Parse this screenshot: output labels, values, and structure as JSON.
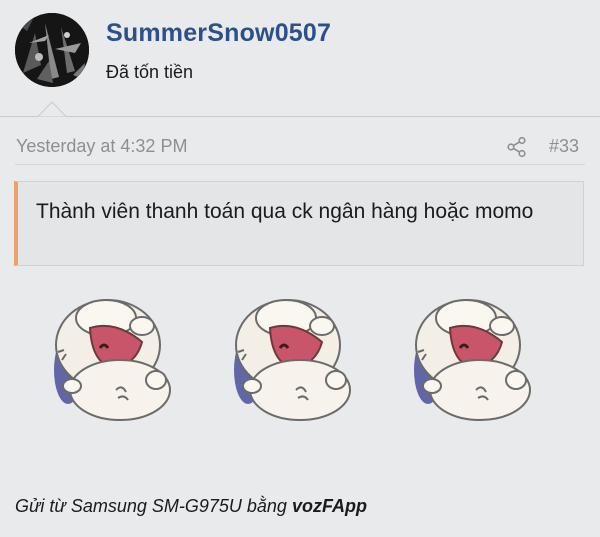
{
  "user": {
    "name": "SummerSnow0507",
    "title": "Đã tốn tiền"
  },
  "post": {
    "time": "Yesterday at 4:32 PM",
    "number": "#33",
    "share_icon": "share-icon"
  },
  "quote": {
    "text": "Thành viên thanh toán qua ck ngân hàng hoặc momo"
  },
  "stickers": {
    "count": 3,
    "icon": "laughing-pig-sticker"
  },
  "signature": {
    "prefix": "Gửi từ Samsung SM-G975U bằng ",
    "app": "vozFApp"
  },
  "colors": {
    "username": "#2d5186",
    "quote_accent": "#f0a070",
    "background": "#e9eaec",
    "muted_text": "#8d8f93"
  }
}
